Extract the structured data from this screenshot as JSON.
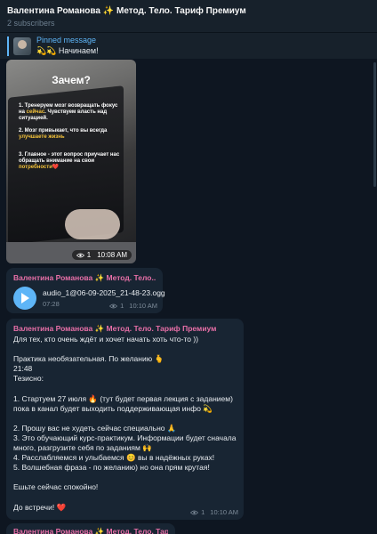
{
  "header": {
    "title": "Валентина Романова ✨ Метод. Тело. Тариф Премиум",
    "subtitle": "2 subscribers"
  },
  "pinned": {
    "label": "Pinned message",
    "text": "💫💫 Начинаем!"
  },
  "photo_post": {
    "overlay_title": "Зачем?",
    "point1_a": "1. Тренеруем мозг возвращать фокус на ",
    "point1_hl": "сейчас",
    "point1_b": ". Чувствуем власть над ситуацией.",
    "point2_a": "2. Мозг привыкает, что вы всегда ",
    "point2_hl": "улучшаете жизнь",
    "point3_a": "3. Главное - этот вопрос приучает нас обращать внимание на свои ",
    "point3_hl": "потребности",
    "point3_b": "❤️",
    "views": "1",
    "time": "10:08 AM"
  },
  "audio_post": {
    "sender": "Валентина Романова ✨ Метод. Тело....",
    "file_name": "audio_1@06-09-2025_21-48-23.ogg",
    "duration": "07:28",
    "views": "1",
    "time": "10:10 AM"
  },
  "text_post": {
    "sender": "Валентина Романова ✨ Метод. Тело. Тариф Премиум",
    "lines": [
      "Для тех, кто очень ждёт и хочет начать хоть что-то ))",
      "",
      "Практика необязательная. По желанию 🫰",
      "21:48",
      "Тезисно:",
      "",
      "1. Стартуем 27 июля 🔥 (тут будет первая лекция с заданием)",
      "пока в канал будет выходить поддерживающая инфо 💫",
      "",
      "2. Прошу вас не худеть сейчас специально 🙏",
      "3. Это обучающий курс-практикум. Информации будет сначала",
      "много, разгрузите себя по заданиям 🙌",
      "4. Расслабляемся и улыбаемся 😊 вы в надёжных руках!",
      "5. Волшебная фраза - по желанию) но она прям крутая!",
      "",
      "Ешьте сейчас спокойно!",
      "",
      "До встречи! ❤️"
    ],
    "views": "1",
    "time": "10:10 AM"
  },
  "next_post": {
    "sender": "Валентина Романова ✨ Метод. Тело. Тариф Премиум"
  },
  "colors": {
    "background": "#0e1621",
    "header": "#17212b",
    "bubble": "#182533",
    "accent": "#5eb5f7",
    "sender": "#e76fa7",
    "highlight": "#f3c23b"
  }
}
